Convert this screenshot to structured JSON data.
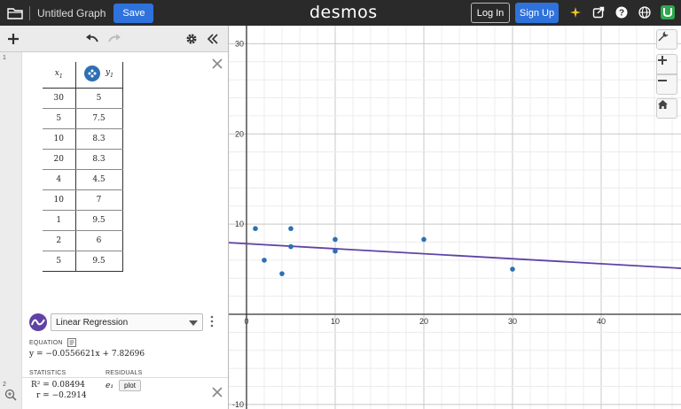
{
  "topbar": {
    "graph_title": "Untitled Graph",
    "save_label": "Save",
    "logo": "desmos",
    "login_label": "Log In",
    "signup_label": "Sign Up"
  },
  "expressions": {
    "row1_number": "1",
    "row2_number": "2",
    "table": {
      "x_header": "x",
      "x_sub": "1",
      "y_header": "y",
      "y_sub": "1",
      "rows": [
        {
          "x": "30",
          "y": "5"
        },
        {
          "x": "5",
          "y": "7.5"
        },
        {
          "x": "10",
          "y": "8.3"
        },
        {
          "x": "20",
          "y": "8.3"
        },
        {
          "x": "4",
          "y": "4.5"
        },
        {
          "x": "10",
          "y": "7"
        },
        {
          "x": "1",
          "y": "9.5"
        },
        {
          "x": "2",
          "y": "6"
        },
        {
          "x": "5",
          "y": "9.5"
        }
      ]
    },
    "regression": {
      "type_label": "Linear Regression",
      "equation_label": "EQUATION",
      "equation": "y = −0.0556621x + 7.82696",
      "statistics_label": "STATISTICS",
      "residuals_label": "RESIDUALS",
      "r2": "R² = 0.08494",
      "r": "r = −0.2914",
      "residual_var": "e₁",
      "plot_label": "plot"
    }
  },
  "colors": {
    "point": "#2d70b3",
    "line": "#6042a6",
    "accent": "#2f72dc"
  },
  "chart_data": {
    "type": "scatter",
    "points": [
      [
        30,
        5
      ],
      [
        5,
        7.5
      ],
      [
        10,
        8.3
      ],
      [
        20,
        8.3
      ],
      [
        4,
        4.5
      ],
      [
        10,
        7
      ],
      [
        1,
        9.5
      ],
      [
        2,
        6
      ],
      [
        5,
        9.5
      ]
    ],
    "regression": {
      "slope": -0.0556621,
      "intercept": 7.82696
    },
    "xlim": [
      -2,
      49
    ],
    "ylim": [
      -10.5,
      32
    ],
    "x_ticks": [
      0,
      10,
      20,
      30,
      40
    ],
    "y_ticks": [
      -10,
      10,
      20,
      30
    ],
    "x_tick_labels": [
      "0",
      "10",
      "20",
      "30",
      "40"
    ],
    "y_tick_labels": [
      "-10",
      "10",
      "20",
      "30"
    ],
    "minor_step": 2,
    "grid": true
  }
}
